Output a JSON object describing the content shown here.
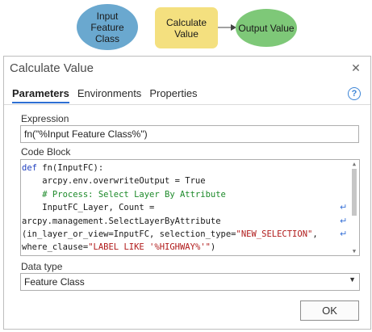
{
  "diagram": {
    "input_node": "Input\nFeature\nClass",
    "tool_node": "Calculate\nValue",
    "output_node": "Output Value",
    "colors": {
      "input": "#6aa8cf",
      "tool": "#f4e07f",
      "output": "#7ec878"
    }
  },
  "dialog": {
    "title": "Calculate Value",
    "close_icon": "close-icon",
    "tabs": [
      "Parameters",
      "Environments",
      "Properties"
    ],
    "active_tab": "Parameters",
    "help_glyph": "?",
    "expression": {
      "label": "Expression",
      "value": "fn(\"%Input Feature Class%\")"
    },
    "code_block": {
      "label": "Code Block",
      "lines": [
        [
          {
            "t": "def",
            "c": "kw"
          },
          {
            "t": " fn(InputFC):",
            "c": ""
          }
        ],
        [
          {
            "t": "    arcpy.env.overwriteOutput = True",
            "c": ""
          }
        ],
        [
          {
            "t": "    # Process: Select Layer By Attribute",
            "c": "cm"
          }
        ],
        [
          {
            "t": "    InputFC_Layer, Count =",
            "c": ""
          }
        ],
        [
          {
            "t": "arcpy.management.SelectLayerByAttribute",
            "c": ""
          }
        ],
        [
          {
            "t": "(in_layer_or_view=InputFC, selection_type=",
            "c": ""
          },
          {
            "t": "\"NEW_SELECTION\"",
            "c": "st"
          },
          {
            "t": ",",
            "c": ""
          }
        ],
        [
          {
            "t": "where_clause=",
            "c": ""
          },
          {
            "t": "\"LABEL LIKE '%HIGHWAY%'\"",
            "c": "st"
          },
          {
            "t": ")",
            "c": ""
          }
        ]
      ],
      "wrapped_lines": [
        3,
        4,
        5
      ]
    },
    "data_type": {
      "label": "Data type",
      "selected": "Feature Class"
    },
    "ok_label": "OK"
  }
}
